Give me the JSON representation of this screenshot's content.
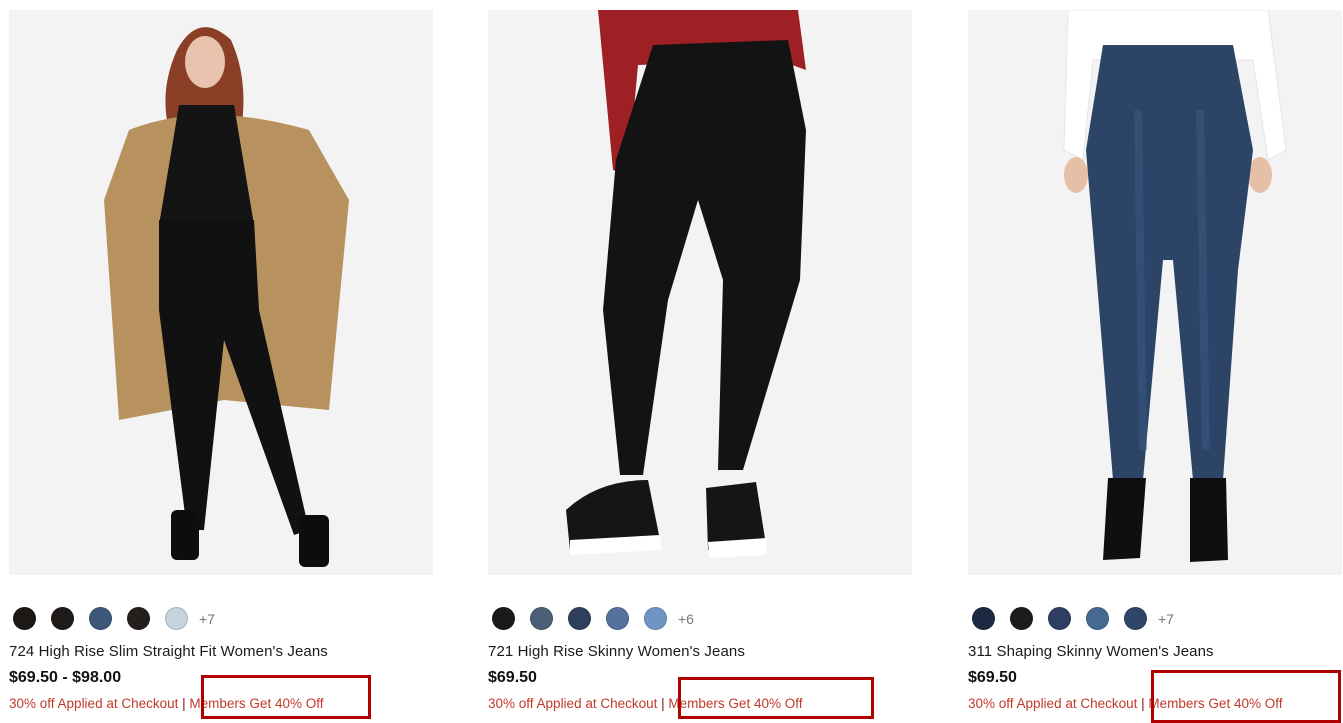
{
  "products": [
    {
      "title": "724 High Rise Slim Straight Fit Women's Jeans",
      "price": "$69.50 - $98.00",
      "promo": "30% off Applied at Checkout",
      "separator": "|",
      "member_promo": "Members Get 40% Off",
      "swatch_colors": [
        "#1c1816",
        "#1f1b19",
        "#3f5779",
        "#241f1c",
        "#c4d3dc"
      ],
      "more_colors": "+7",
      "image_icon": "model-black-jeans-trench-coat"
    },
    {
      "title": "721 High Rise Skinny Women's Jeans",
      "price": "$69.50",
      "promo": "30% off Applied at Checkout",
      "separator": "|",
      "member_promo": "Members Get 40% Off",
      "swatch_colors": [
        "#1c1a19",
        "#4c5f76",
        "#2e3f5e",
        "#55729d",
        "#6f95c4"
      ],
      "more_colors": "+6",
      "image_icon": "model-black-skinny-jeans-sneakers"
    },
    {
      "title": "311 Shaping Skinny Women's Jeans",
      "price": "$69.50",
      "promo": "30% off Applied at Checkout",
      "separator": "|",
      "member_promo": "Members Get 40% Off",
      "swatch_colors": [
        "#1d2a44",
        "#1e1c1b",
        "#2d3e62",
        "#45698f",
        "#2f4668"
      ],
      "more_colors": "+7",
      "image_icon": "model-blue-skinny-jeans-boots"
    }
  ],
  "colors": {
    "promo_red": "#c0392b",
    "highlight_box": "#b00000"
  }
}
